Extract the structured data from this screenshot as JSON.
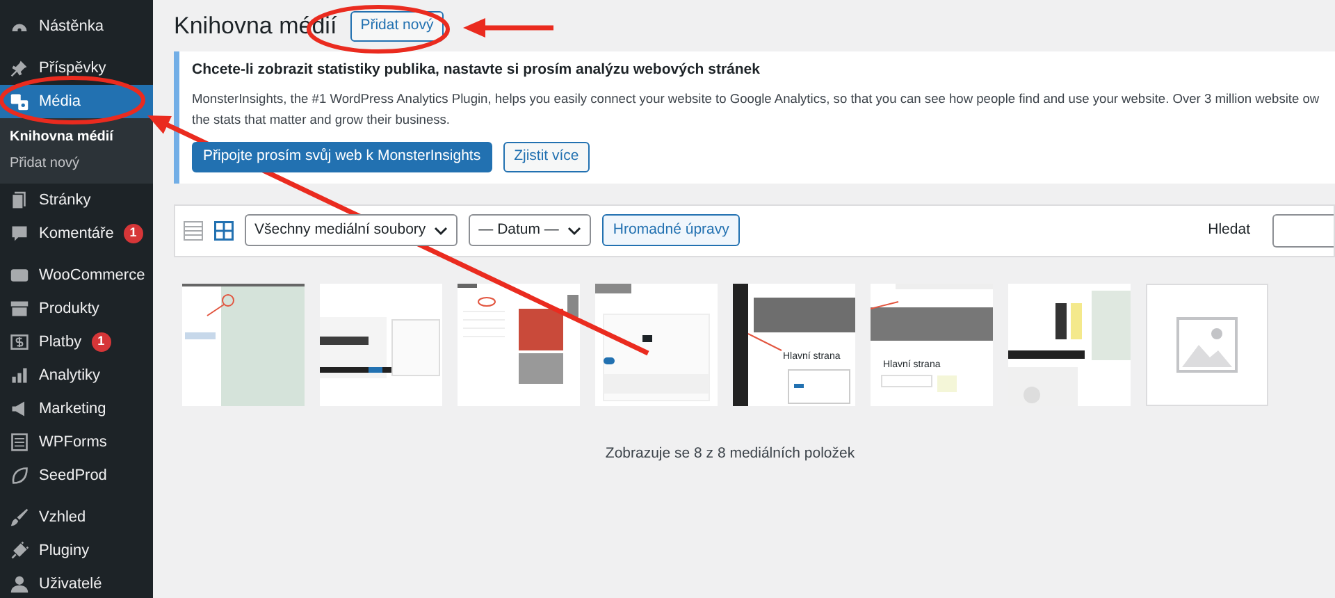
{
  "sidebar": {
    "items": [
      {
        "label": "Nástěnka",
        "selected": false
      },
      {
        "label": "Příspěvky",
        "selected": false
      },
      {
        "label": "Média",
        "selected": true,
        "children": [
          {
            "label": "Knihovna médií",
            "selected": true
          },
          {
            "label": "Přidat nový",
            "selected": false
          }
        ]
      },
      {
        "label": "Stránky",
        "selected": false
      },
      {
        "label": "Komentáře",
        "selected": false,
        "badge": "1"
      },
      {
        "label": "WooCommerce",
        "selected": false
      },
      {
        "label": "Produkty",
        "selected": false
      },
      {
        "label": "Platby",
        "selected": false,
        "badge": "1"
      },
      {
        "label": "Analytiky",
        "selected": false
      },
      {
        "label": "Marketing",
        "selected": false
      },
      {
        "label": "WPForms",
        "selected": false
      },
      {
        "label": "SeedProd",
        "selected": false
      },
      {
        "label": "Vzhled",
        "selected": false
      },
      {
        "label": "Pluginy",
        "selected": false
      },
      {
        "label": "Uživatelé",
        "selected": false
      }
    ]
  },
  "page": {
    "title": "Knihovna médií",
    "add_button": "Přidat nový"
  },
  "notice": {
    "heading": "Chcete-li zobrazit statistiky publika, nastavte si prosím analýzu webových stránek",
    "lines": [
      "MonsterInsights, the #1 WordPress Analytics Plugin, helps you easily connect your website to Google Analytics, so that you can see how people find and use your website. Over 3 million website ow",
      "the stats that matter and grow their business."
    ],
    "primary_button": "Připojte prosím svůj web k MonsterInsights",
    "secondary_button": "Zjistit více"
  },
  "toolbar": {
    "view_modes": [
      {
        "kind": "list",
        "selected": false
      },
      {
        "kind": "grid",
        "selected": true
      }
    ],
    "type_filter": "Všechny mediální soubory",
    "date_filter": "— Datum —",
    "bulk_button": "Hromadné úpravy",
    "search_label": "Hledat"
  },
  "thumbnails": [
    {
      "kind": "picture"
    },
    {
      "kind": "picture"
    },
    {
      "kind": "picture"
    },
    {
      "kind": "picture"
    },
    {
      "kind": "picture",
      "caption": "Hlavní strana"
    },
    {
      "kind": "picture",
      "caption": "Hlavní strana"
    },
    {
      "kind": "picture"
    },
    {
      "kind": "placeholder"
    }
  ],
  "footer": "Zobrazuje se 8 z 8 mediálních položek",
  "annotations": [
    {
      "kind": "ellipse"
    },
    {
      "kind": "ellipse"
    },
    {
      "kind": "arrow"
    },
    {
      "kind": "arrow"
    }
  ]
}
